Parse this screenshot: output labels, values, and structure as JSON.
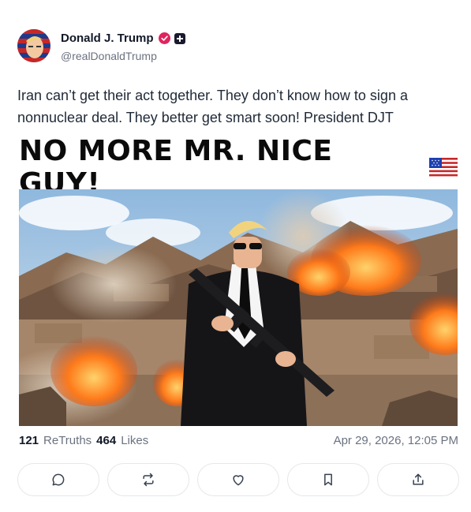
{
  "author": {
    "display_name": "Donald J. Trump",
    "handle": "@realDonaldTrump",
    "verified_badge_icon": "verified-check-icon",
    "badge_color": "#e0245e"
  },
  "post": {
    "text": "Iran can’t get their act together. They don’t know how to sign a nonnuclear deal. They better get smart soon! President DJT"
  },
  "media": {
    "headline": "NO MORE MR. NICE GUY!",
    "flag_icon": "us-flag-icon"
  },
  "stats": {
    "retruths_count": "121",
    "retruths_label": "ReTruths",
    "likes_count": "464",
    "likes_label": "Likes",
    "timestamp": "Apr 29, 2026, 12:05 PM"
  },
  "actions": [
    {
      "icon": "reply-icon"
    },
    {
      "icon": "retruth-icon"
    },
    {
      "icon": "like-heart-icon"
    },
    {
      "icon": "bookmark-icon"
    },
    {
      "icon": "share-icon"
    }
  ],
  "colors": {
    "accent": "#e0245e",
    "muted_text": "#6b7280",
    "border": "#e5e7eb"
  }
}
